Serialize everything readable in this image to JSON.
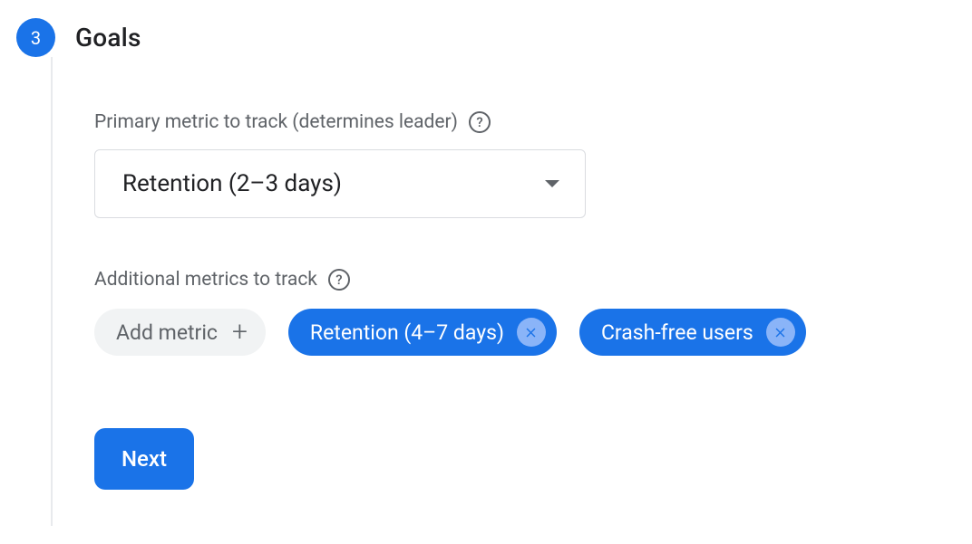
{
  "step": {
    "num": "3",
    "title": "Goals"
  },
  "primary": {
    "label": "Primary metric to track (determines leader)",
    "value": "Retention (2–3 days)"
  },
  "additional": {
    "label": "Additional metrics to track",
    "add": "Add metric",
    "chips": [
      "Retention (4–7 days)",
      "Crash-free users"
    ]
  },
  "next": "Next"
}
